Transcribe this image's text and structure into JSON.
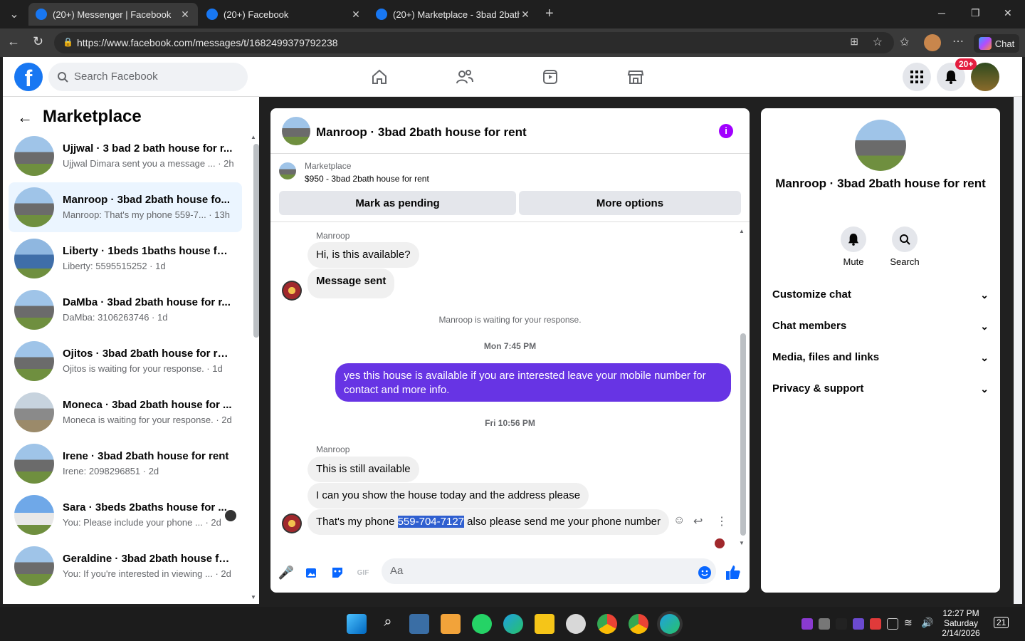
{
  "browser": {
    "tabs": [
      {
        "title": "(20+) Messenger | Facebook",
        "close": "✕"
      },
      {
        "title": "(20+) Facebook",
        "close": "✕"
      },
      {
        "title": "(20+) Marketplace - 3bad 2bath h",
        "close": "✕"
      }
    ],
    "new_tab": "+",
    "url": "https://www.facebook.com/messages/t/1682499379792238",
    "chat_label": "Chat"
  },
  "header": {
    "logo": "f",
    "search_placeholder": "Search Facebook",
    "notif_badge": "20+"
  },
  "sidebar": {
    "title": "Marketplace",
    "conversations": [
      {
        "name": "Ujjwal · 3 bad 2 bath house for r...",
        "snippet": "Ujjwal Dimara sent you a message ... · 2h"
      },
      {
        "name": "Manroop · 3bad 2bath house fo...",
        "snippet": "Manroop: That's my phone 559-7... · 13h"
      },
      {
        "name": "Liberty · 1beds 1baths house for ...",
        "snippet": "Liberty: 5595515252 · 1d"
      },
      {
        "name": "DaMba · 3bad 2bath house for r...",
        "snippet": "DaMba: 3106263746 · 1d"
      },
      {
        "name": "Ojitos · 3bad 2bath house for rent",
        "snippet": "Ojitos is waiting for your response. · 1d"
      },
      {
        "name": "Moneca · 3bad 2bath house for ...",
        "snippet": "Moneca is waiting for your response. · 2d"
      },
      {
        "name": "Irene · 3bad 2bath house for rent",
        "snippet": "Irene: 2098296851 · 2d"
      },
      {
        "name": "Sara · 3beds 2baths house for ...",
        "snippet": "You: Please include your phone ... · 2d"
      },
      {
        "name": "Geraldine · 3bad 2bath house fo...",
        "snippet": "You: If you're interested in viewing ... · 2d"
      }
    ]
  },
  "chat": {
    "title": "Manroop · 3bad 2bath house for rent",
    "marketplace_label": "Marketplace",
    "listing": "$950 - 3bad 2bath house for rent",
    "mark_pending": "Mark as pending",
    "more_options": "More options",
    "sender1": "Manroop",
    "msg1": "Hi, is this available?",
    "msg2": "Message sent",
    "waiting": "Manroop is waiting for your response.",
    "time1": "Mon 7:45 PM",
    "own_msg": "yes this house is available if  you are  interested leave your mobile number for contact and more info.",
    "time2": "Fri 10:56 PM",
    "sender2": "Manroop",
    "msg3": "This is still available",
    "msg4": "I can you show the house today and the address please",
    "msg5_pre": "That's my phone ",
    "msg5_phone": "559-704-7127",
    "msg5_post": " also please send me your phone number",
    "composer_placeholder": "Aa"
  },
  "right_panel": {
    "name": "Manroop · 3bad 2bath house for rent",
    "mute": "Mute",
    "search": "Search",
    "sections": [
      "Customize chat",
      "Chat members",
      "Media, files and links",
      "Privacy & support"
    ]
  },
  "taskbar": {
    "time": "12:27 PM",
    "day": "Saturday",
    "date": "2/14/2026",
    "notif_count": "21"
  }
}
